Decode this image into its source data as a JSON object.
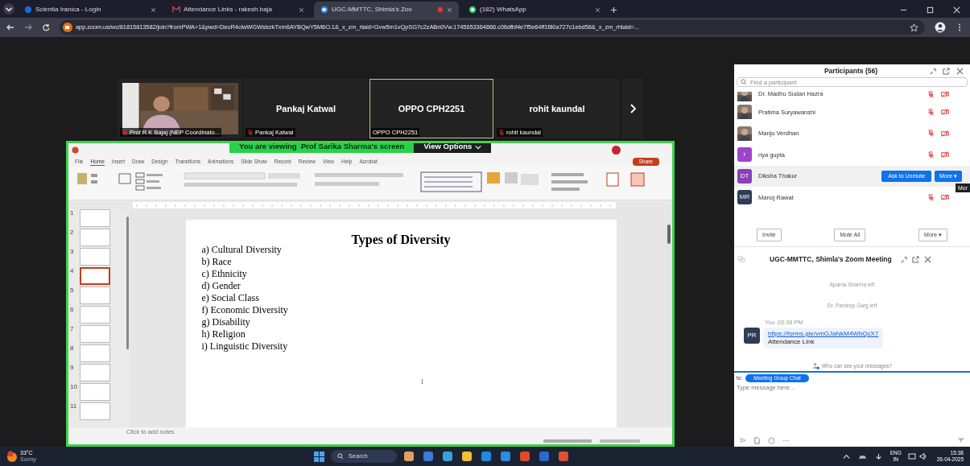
{
  "browser": {
    "tabs": [
      {
        "title": "Scientia Iranica - Login",
        "selected": false
      },
      {
        "title": "Attendance Links - rakesh.baja",
        "selected": false
      },
      {
        "title": "UGC-MMTTC, Shimla's Zoo",
        "selected": true
      },
      {
        "title": "(182) WhatsApp",
        "selected": false
      }
    ],
    "address": "app.zoom.us/wc/81815813582/join?fromPWA=1&pwd=DeoR4clwWGWstcrkTxm6AYBQwY5M6O.1&_x_zm_rtaid=Gvw5m1vQpSG7c2zABn0Vw.1745653364866.c06dfbf4e7f5e64ff1f80a727c1ebd58&_x_zm_rhtaid=..."
  },
  "video_strip": {
    "tiles": [
      {
        "kind": "video",
        "label": "Prof R K Bajaj (NEP Coordinato...",
        "muted": true,
        "active_speaker": false
      },
      {
        "kind": "name",
        "name": "Pankaj Katwal",
        "label": "Pankaj Katwal",
        "muted": true,
        "active_speaker": false
      },
      {
        "kind": "name",
        "name": "OPPO CPH2251",
        "label": "OPPO CPH2251",
        "muted": false,
        "active_speaker": true
      },
      {
        "kind": "name",
        "name": "rohit kaundal",
        "label": "rohit kaundal",
        "muted": true,
        "active_speaker": false
      }
    ]
  },
  "share_banner": {
    "text": "You are viewing  Prof Sarika Sharma's screen",
    "button": "View Options"
  },
  "presentation": {
    "menu_tabs": [
      {
        "label": "File",
        "selected": false
      },
      {
        "label": "Home",
        "selected": true
      },
      {
        "label": "Insert",
        "selected": false
      },
      {
        "label": "Draw",
        "selected": false
      },
      {
        "label": "Design",
        "selected": false
      },
      {
        "label": "Transitions",
        "selected": false
      },
      {
        "label": "Animations",
        "selected": false
      },
      {
        "label": "Slide Show",
        "selected": false
      },
      {
        "label": "Record",
        "selected": false
      },
      {
        "label": "Review",
        "selected": false
      },
      {
        "label": "View",
        "selected": false
      },
      {
        "label": "Help",
        "selected": false
      },
      {
        "label": "Acrobat",
        "selected": false
      }
    ],
    "share_button": "Share",
    "thumbnails": [
      {
        "number": "1",
        "selected": false
      },
      {
        "number": "2",
        "selected": false
      },
      {
        "number": "3",
        "selected": false
      },
      {
        "number": "4",
        "selected": true
      },
      {
        "number": "5",
        "selected": false
      },
      {
        "number": "6",
        "selected": false
      },
      {
        "number": "7",
        "selected": false
      },
      {
        "number": "8",
        "selected": false
      },
      {
        "number": "9",
        "selected": false
      },
      {
        "number": "10",
        "selected": false
      },
      {
        "number": "11",
        "selected": false
      }
    ],
    "slide": {
      "title": "Types of Diversity",
      "items": [
        "a) Cultural Diversity",
        "b) Race",
        "c) Ethnicity",
        "d) Gender",
        "e) Social Class",
        "f) Economic Diversity",
        "g) Disability",
        "h) Religion",
        "i) Linguistic Diversity"
      ],
      "page_number": "1"
    },
    "notes_placeholder": "Click to add notes"
  },
  "participants": {
    "title": "Participants (56)",
    "search_placeholder": "Find a participant",
    "items": [
      {
        "name": "Dr. Madhu Sudan Hazra",
        "muted": true,
        "video_off": true,
        "hovered": false
      },
      {
        "name": "Pratima Suryawanshi",
        "muted": true,
        "video_off": true,
        "hovered": false
      },
      {
        "name": "Manju Verdhan",
        "muted": true,
        "video_off": true,
        "hovered": false
      },
      {
        "name": "riya gupta",
        "avatar": {
          "kind": "initials",
          "initials": "r",
          "color": "#a043c9"
        },
        "muted": true,
        "video_off": true,
        "hovered": false
      },
      {
        "name": "Diksha Thakur",
        "avatar": {
          "kind": "initials",
          "initials": "DT",
          "color": "#8b3fba"
        },
        "hovered": true
      },
      {
        "name": "Manoj Rawat",
        "avatar": {
          "kind": "initials",
          "initials": "MR",
          "color": "#2e3d55"
        },
        "muted": true,
        "video_off": true,
        "hovered": false
      }
    ],
    "hover_actions": [
      "Ask to Unmute",
      "More ▾"
    ],
    "tooltip": "Mor",
    "buttons": [
      "Invite",
      "Mute All",
      "More ▾"
    ]
  },
  "chat": {
    "title": "UGC-MMTTC, Shimla's Zoom Meeting",
    "messages": [
      {
        "kind": "system",
        "text": "Aparna Sharma left"
      },
      {
        "kind": "system",
        "text": "Dr. Pardeep Garg left"
      },
      {
        "kind": "message",
        "sender": "You",
        "time": "03:38 PM",
        "initials": "PR",
        "link": "https://forms.gle/vmGJaNkM4WbQcX7",
        "text": "Attendance Link"
      }
    ],
    "privacy_note": "Who can see your messages?",
    "to_label": "to:",
    "recipient": "Meeting Group Chat",
    "placeholder": "Type message here..."
  },
  "taskbar": {
    "temperature": "33°C",
    "weather": "Sunny",
    "search": "Search",
    "language": "ENG",
    "region": "IN",
    "time": "15:38",
    "date": "26-04-2025"
  }
}
